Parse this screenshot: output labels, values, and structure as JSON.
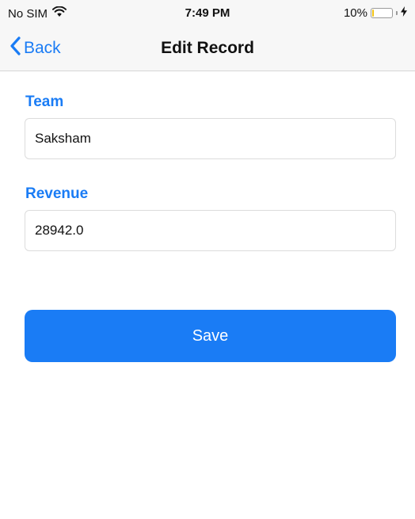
{
  "status_bar": {
    "carrier": "No SIM",
    "time": "7:49 PM",
    "battery_percent_label": "10%",
    "battery_level": 0.1,
    "icons": [
      "wifi-icon",
      "battery-icon",
      "charging-bolt-icon"
    ]
  },
  "nav": {
    "back_label": "Back",
    "title": "Edit Record",
    "back_icon": "chevron-left-icon"
  },
  "form": {
    "team": {
      "label": "Team",
      "value": "Saksham"
    },
    "revenue": {
      "label": "Revenue",
      "value": "28942.0"
    },
    "save_label": "Save"
  },
  "colors": {
    "accent": "#1a7cf5",
    "nav_background": "#f7f7f7",
    "battery_fill": "#f2c311"
  }
}
